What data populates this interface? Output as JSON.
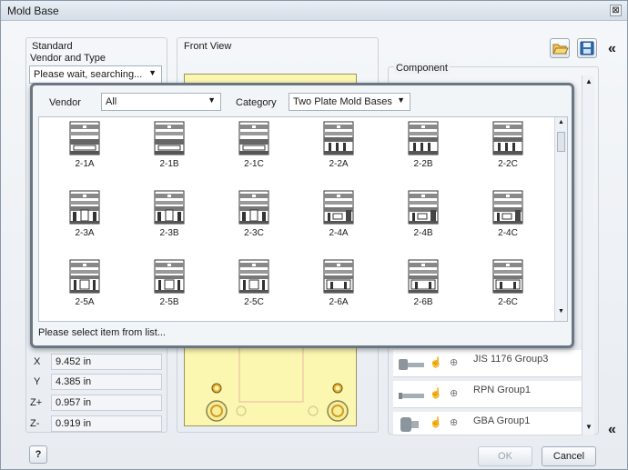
{
  "window": {
    "title": "Mold Base",
    "close_glyph": "⊠"
  },
  "left_panel": {
    "standard_label": "Standard",
    "vendor_type_label": "Vendor and Type",
    "vendor_type_value": "Please wait, searching...",
    "coords": [
      {
        "axis": "X",
        "value": "9.452 in"
      },
      {
        "axis": "Y",
        "value": "4.385 in"
      },
      {
        "axis": "Z+",
        "value": "0.957 in"
      },
      {
        "axis": "Z-",
        "value": "0.919 in"
      }
    ]
  },
  "front_view": {
    "label": "Front View"
  },
  "component": {
    "label": "Component",
    "rows": [
      {
        "name": "JIS 1176 Group3"
      },
      {
        "name": "RPN Group1"
      },
      {
        "name": "GBA Group1"
      }
    ]
  },
  "toolbar": {
    "open_icon": "folder-open-icon",
    "save_icon": "save-icon",
    "collapse_glyph": "«"
  },
  "popup": {
    "vendor_label": "Vendor",
    "vendor_value": "All",
    "category_label": "Category",
    "category_value": "Two Plate Mold Bases",
    "items": [
      {
        "label": "2-1A",
        "kind": 1
      },
      {
        "label": "2-1B",
        "kind": 1
      },
      {
        "label": "2-1C",
        "kind": 1
      },
      {
        "label": "2-2A",
        "kind": 2
      },
      {
        "label": "2-2B",
        "kind": 2
      },
      {
        "label": "2-2C",
        "kind": 2
      },
      {
        "label": "2-3A",
        "kind": 3
      },
      {
        "label": "2-3B",
        "kind": 3
      },
      {
        "label": "2-3C",
        "kind": 3
      },
      {
        "label": "2-4A",
        "kind": 4
      },
      {
        "label": "2-4B",
        "kind": 4
      },
      {
        "label": "2-4C",
        "kind": 4
      },
      {
        "label": "2-5A",
        "kind": 5
      },
      {
        "label": "2-5B",
        "kind": 5
      },
      {
        "label": "2-5C",
        "kind": 5
      },
      {
        "label": "2-6A",
        "kind": 6
      },
      {
        "label": "2-6B",
        "kind": 6
      },
      {
        "label": "2-6C",
        "kind": 6
      }
    ],
    "status": "Please select item from list..."
  },
  "footer": {
    "help_glyph": "?",
    "ok_label": "OK",
    "cancel_label": "Cancel"
  },
  "colors": {
    "plate_yellow": "#fbf7b0",
    "accent_blue": "#1e6fb8"
  }
}
